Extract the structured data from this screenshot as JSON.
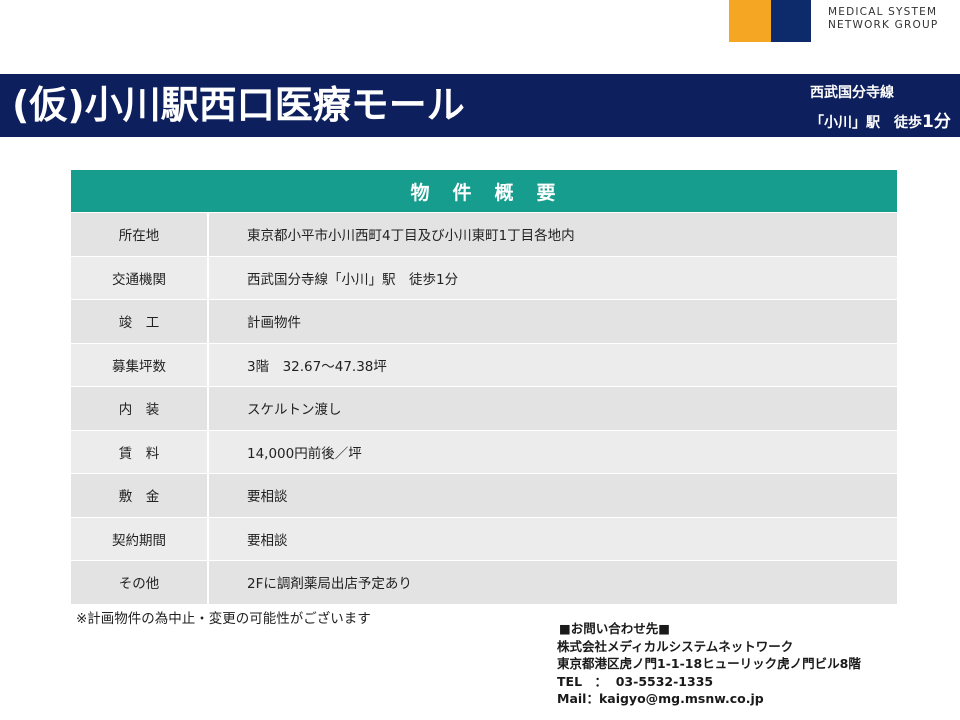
{
  "logo": {
    "line1": "MEDICAL SYSTEM",
    "line2": "NETWORK GROUP",
    "colors": {
      "orange": "#f5a623",
      "navy": "#0d2b6b"
    }
  },
  "header": {
    "title": "(仮)小川駅西口医療モール",
    "access_line": "西武国分寺線",
    "station": "「小川」駅　徒歩",
    "minutes": "1分",
    "background": "#0d1f5c"
  },
  "table": {
    "heading": "物　件　概　要",
    "header_color": "#179d8e",
    "rows": [
      {
        "label": "所在地",
        "value": "東京都小平市小川西町4丁目及び小川東町1丁目各地内"
      },
      {
        "label": "交通機関",
        "value": "西武国分寺線「小川」駅　徒歩1分"
      },
      {
        "label": "竣　工",
        "value": "計画物件"
      },
      {
        "label": "募集坪数",
        "value": "3階　32.67～47.38坪"
      },
      {
        "label": "内　装",
        "value": "スケルトン渡し"
      },
      {
        "label": "賃　料",
        "value": "14,000円前後／坪"
      },
      {
        "label": "敷　金",
        "value": "要相談"
      },
      {
        "label": "契約期間",
        "value": "要相談"
      },
      {
        "label": "その他",
        "value": "2Fに調剤薬局出店予定あり"
      }
    ]
  },
  "note": "※計画物件の為中止・変更の可能性がございます",
  "contact": {
    "heading": "■お問い合わせ先■",
    "company": "株式会社メディカルシステムネットワーク",
    "address": "東京都港区虎ノ門1-1-18ヒューリック虎ノ門ビル8階",
    "tel": "TEL　：  03-5532-1335",
    "mail": "Mail：kaigyo@mg.msnw.co.jp"
  }
}
